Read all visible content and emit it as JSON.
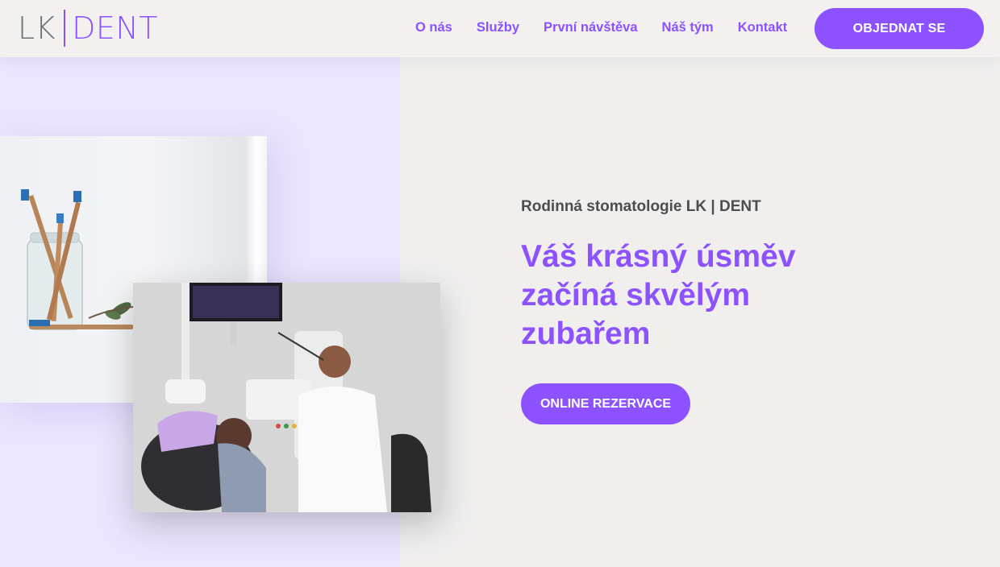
{
  "header": {
    "logo": {
      "part1": "LK",
      "part2": "DENT"
    },
    "nav": [
      "O nás",
      "Služby",
      "První návštěva",
      "Náš tým",
      "Kontakt"
    ],
    "cta": "OBJEDNAT SE"
  },
  "hero": {
    "eyebrow": "Rodinná stomatologie LK | DENT",
    "headline": [
      "Váš krásný úsměv",
      "začíná skvělým",
      "zubařem"
    ],
    "button": "ONLINE REZERVACE"
  },
  "colors": {
    "accent": "#8c52ff",
    "panel": "#ede5fe",
    "background": "#f0efee",
    "text": "#4d4d4d"
  },
  "images": [
    "toothbrushes-in-jar-photo",
    "dentist-with-patient-photo"
  ]
}
